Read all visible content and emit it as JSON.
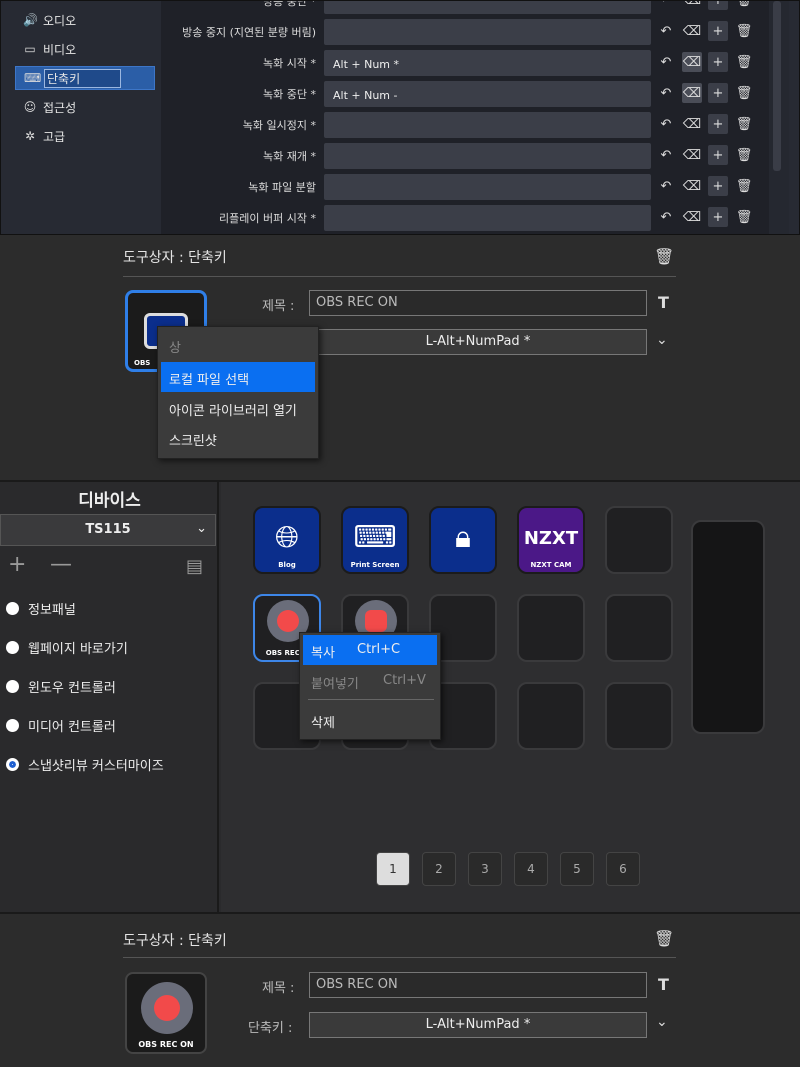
{
  "obs_settings": {
    "sidebar": [
      {
        "label": "오디오",
        "icon": "speaker-icon"
      },
      {
        "label": "비디오",
        "icon": "monitor-icon"
      },
      {
        "label": "단축키",
        "icon": "keyboard-icon",
        "active": true
      },
      {
        "label": "접근성",
        "icon": "accessibility-icon"
      },
      {
        "label": "고급",
        "icon": "tools-icon"
      }
    ],
    "rows": [
      {
        "label": "방송 중단 *",
        "value": ""
      },
      {
        "label": "방송 중지 (지연된 분량 버림)",
        "value": ""
      },
      {
        "label": "녹화 시작 *",
        "value": "Alt + Num *"
      },
      {
        "label": "녹화 중단 *",
        "value": "Alt + Num -"
      },
      {
        "label": "녹화 일시정지 *",
        "value": ""
      },
      {
        "label": "녹화 재개 *",
        "value": ""
      },
      {
        "label": "녹화 파일 분할",
        "value": ""
      },
      {
        "label": "리플레이 버퍼 시작 *",
        "value": ""
      }
    ]
  },
  "toolbox_top": {
    "title": "도구상자 : 단축키",
    "title_label": "제목 :",
    "title_value": "OBS REC ON",
    "shortcut_value": "L-Alt+NumPad *",
    "icon_label": "OBS",
    "context_menu": {
      "partial": "상",
      "items": [
        "로컬 파일 선택",
        "아이콘 라이브러리 열기",
        "스크린샷"
      ]
    }
  },
  "device": {
    "title": "디바이스",
    "selected": "TS115",
    "categories": [
      {
        "label": "정보패널",
        "selected": false
      },
      {
        "label": "웹페이지 바로가기",
        "selected": false
      },
      {
        "label": "윈도우 컨트롤러",
        "selected": false
      },
      {
        "label": "미디어 컨트롤러",
        "selected": false
      },
      {
        "label": "스냅샷리뷰 커스터마이즈",
        "selected": true
      }
    ],
    "keys": [
      {
        "label": "Blog",
        "icon": "globe-icon"
      },
      {
        "label": "Print Screen",
        "icon": "keyboard-icon"
      },
      {
        "label": "",
        "icon": "lock-icon"
      },
      {
        "label": "NZXT CAM",
        "logo": "NZXT"
      },
      {
        "label": "OBS REC O",
        "icon": "record-icon"
      }
    ],
    "context_menu": {
      "copy": "복사",
      "copy_sc": "Ctrl+C",
      "paste": "붙여넣기",
      "paste_sc": "Ctrl+V",
      "delete": "삭제"
    },
    "pages": [
      "1",
      "2",
      "3",
      "4",
      "5",
      "6"
    ]
  },
  "toolbox_bottom": {
    "title": "도구상자 : 단축키",
    "title_label": "제목 :",
    "title_value": "OBS REC ON",
    "shortcut_label": "단축키 :",
    "shortcut_value": "L-Alt+NumPad *",
    "icon_label": "OBS REC ON"
  }
}
